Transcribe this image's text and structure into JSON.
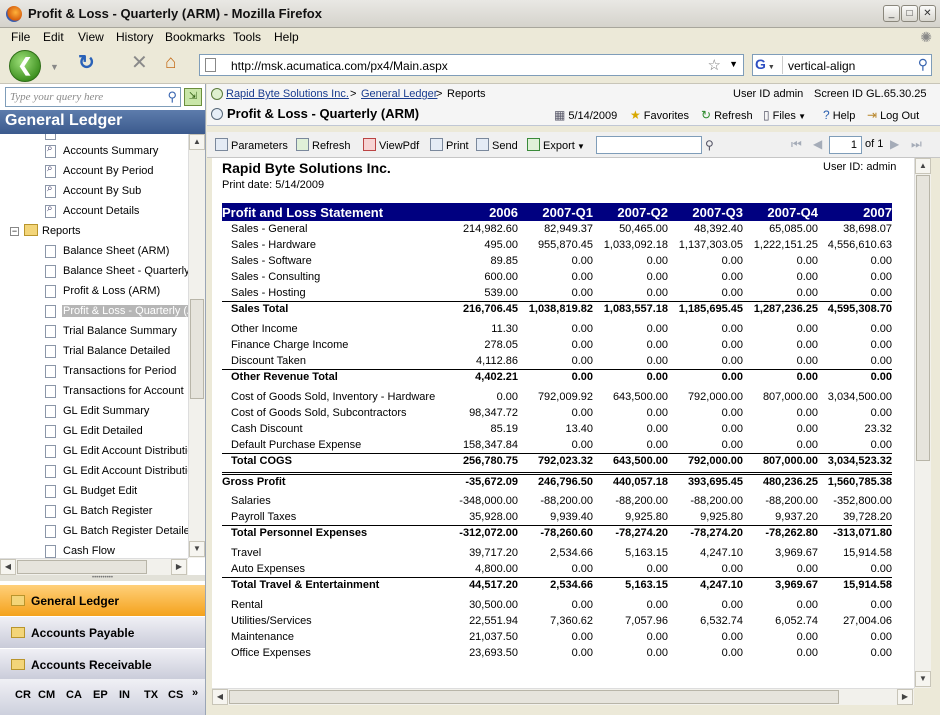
{
  "browser": {
    "title": "Profit & Loss - Quarterly (ARM) - Mozilla Firefox",
    "menu": [
      "File",
      "Edit",
      "View",
      "History",
      "Bookmarks",
      "Tools",
      "Help"
    ],
    "url": "http://msk.acumatica.com/px4/Main.aspx",
    "search_value": "vertical-align",
    "search_engine": "G"
  },
  "sidebar": {
    "query_placeholder": "Type your query here",
    "header": "General Ledger",
    "items": [
      {
        "label": "Accounts Summary",
        "icon": "search-report-icon"
      },
      {
        "label": "Account By Period",
        "icon": "search-report-icon"
      },
      {
        "label": "Account By Sub",
        "icon": "search-report-icon"
      },
      {
        "label": "Account Details",
        "icon": "search-report-icon"
      },
      {
        "label": "Reports",
        "icon": "folder-icon",
        "folder": true
      },
      {
        "label": "Balance Sheet (ARM)",
        "icon": "report-icon"
      },
      {
        "label": "Balance Sheet - Quarterly",
        "icon": "report-icon"
      },
      {
        "label": "Profit & Loss (ARM)",
        "icon": "report-icon"
      },
      {
        "label": "Profit & Loss - Quarterly (ARM)",
        "icon": "report-icon",
        "selected": true
      },
      {
        "label": "Trial Balance Summary",
        "icon": "report-icon"
      },
      {
        "label": "Trial Balance Detailed",
        "icon": "report-icon"
      },
      {
        "label": "Transactions for Period",
        "icon": "report-icon"
      },
      {
        "label": "Transactions for Account",
        "icon": "report-icon"
      },
      {
        "label": "GL Edit Summary",
        "icon": "report-icon"
      },
      {
        "label": "GL Edit Detailed",
        "icon": "report-icon"
      },
      {
        "label": "GL Edit Account Distribution",
        "icon": "report-icon"
      },
      {
        "label": "GL Edit Account Distribution",
        "icon": "report-icon"
      },
      {
        "label": "GL Budget Edit",
        "icon": "report-icon"
      },
      {
        "label": "GL Batch Register",
        "icon": "report-icon"
      },
      {
        "label": "GL Batch Register Detailed",
        "icon": "report-icon"
      },
      {
        "label": "Cash Flow",
        "icon": "report-icon"
      }
    ],
    "modules": [
      {
        "label": "General Ledger",
        "active": true
      },
      {
        "label": "Accounts Payable",
        "active": false
      },
      {
        "label": "Accounts Receivable",
        "active": false
      }
    ],
    "shortcuts": [
      "CR",
      "CM",
      "CA",
      "EP",
      "IN",
      "TX",
      "CS"
    ]
  },
  "header": {
    "breadcrumb_company": "Rapid Byte Solutions Inc.",
    "breadcrumb_module": "General Ledger",
    "breadcrumb_section": "Reports",
    "user_id": "User ID admin",
    "screen_id": "Screen ID GL.65.30.25",
    "screen_title": "Profit & Loss - Quarterly (ARM)",
    "date": "5/14/2009",
    "tools": [
      "Favorites",
      "Refresh",
      "Files",
      "Help",
      "Log Out"
    ]
  },
  "report_toolbar": {
    "buttons": [
      "Parameters",
      "Refresh",
      "ViewPdf",
      "Print",
      "Send",
      "Export"
    ],
    "page": "1",
    "page_of": "of 1"
  },
  "report": {
    "company": "Rapid Byte Solutions Inc.",
    "print_date": "Print date: 5/14/2009",
    "user": "User ID: admin",
    "heading": "Profit and Loss Statement",
    "columns": [
      "2006",
      "2007-Q1",
      "2007-Q2",
      "2007-Q3",
      "2007-Q4",
      "2007"
    ],
    "rows": [
      {
        "type": "line",
        "label": "Sales - General",
        "values": [
          "214,982.60",
          "82,949.37",
          "50,465.00",
          "48,392.40",
          "65,085.00",
          "38,698.07"
        ]
      },
      {
        "type": "line",
        "label": "Sales - Hardware",
        "values": [
          "495.00",
          "955,870.45",
          "1,033,092.18",
          "1,137,303.05",
          "1,222,151.25",
          "4,556,610.63"
        ]
      },
      {
        "type": "line",
        "label": "Sales - Software",
        "values": [
          "89.85",
          "0.00",
          "0.00",
          "0.00",
          "0.00",
          "0.00"
        ]
      },
      {
        "type": "line",
        "label": "Sales - Consulting",
        "values": [
          "600.00",
          "0.00",
          "0.00",
          "0.00",
          "0.00",
          "0.00"
        ]
      },
      {
        "type": "line",
        "label": "Sales - Hosting",
        "values": [
          "539.00",
          "0.00",
          "0.00",
          "0.00",
          "0.00",
          "0.00"
        ]
      },
      {
        "type": "total",
        "label": "Sales Total",
        "values": [
          "216,706.45",
          "1,038,819.82",
          "1,083,557.18",
          "1,185,695.45",
          "1,287,236.25",
          "4,595,308.70"
        ]
      },
      {
        "type": "line",
        "label": "Other Income",
        "values": [
          "11.30",
          "0.00",
          "0.00",
          "0.00",
          "0.00",
          "0.00"
        ]
      },
      {
        "type": "line",
        "label": "Finance Charge Income",
        "values": [
          "278.05",
          "0.00",
          "0.00",
          "0.00",
          "0.00",
          "0.00"
        ]
      },
      {
        "type": "line",
        "label": "Discount Taken",
        "values": [
          "4,112.86",
          "0.00",
          "0.00",
          "0.00",
          "0.00",
          "0.00"
        ]
      },
      {
        "type": "total",
        "label": "Other Revenue Total",
        "values": [
          "4,402.21",
          "0.00",
          "0.00",
          "0.00",
          "0.00",
          "0.00"
        ]
      },
      {
        "type": "line",
        "label": "Cost of Goods Sold, Inventory - Hardware",
        "values": [
          "0.00",
          "792,009.92",
          "643,500.00",
          "792,000.00",
          "807,000.00",
          "3,034,500.00"
        ]
      },
      {
        "type": "line",
        "label": "Cost of Goods Sold, Subcontractors",
        "values": [
          "98,347.72",
          "0.00",
          "0.00",
          "0.00",
          "0.00",
          "0.00"
        ]
      },
      {
        "type": "line",
        "label": "Cash Discount",
        "values": [
          "85.19",
          "13.40",
          "0.00",
          "0.00",
          "0.00",
          "23.32"
        ]
      },
      {
        "type": "line",
        "label": "Default Purchase Expense",
        "values": [
          "158,347.84",
          "0.00",
          "0.00",
          "0.00",
          "0.00",
          "0.00"
        ]
      },
      {
        "type": "total",
        "label": "Total COGS",
        "values": [
          "256,780.75",
          "792,023.32",
          "643,500.00",
          "792,000.00",
          "807,000.00",
          "3,034,523.32"
        ]
      },
      {
        "type": "gross",
        "label": "Gross Profit",
        "values": [
          "-35,672.09",
          "246,796.50",
          "440,057.18",
          "393,695.45",
          "480,236.25",
          "1,560,785.38"
        ]
      },
      {
        "type": "line",
        "label": "Salaries",
        "values": [
          "-348,000.00",
          "-88,200.00",
          "-88,200.00",
          "-88,200.00",
          "-88,200.00",
          "-352,800.00"
        ]
      },
      {
        "type": "line",
        "label": "Payroll Taxes",
        "values": [
          "35,928.00",
          "9,939.40",
          "9,925.80",
          "9,925.80",
          "9,937.20",
          "39,728.20"
        ]
      },
      {
        "type": "total",
        "label": "Total Personnel Expenses",
        "values": [
          "-312,072.00",
          "-78,260.60",
          "-78,274.20",
          "-78,274.20",
          "-78,262.80",
          "-313,071.80"
        ]
      },
      {
        "type": "line",
        "label": "Travel",
        "values": [
          "39,717.20",
          "2,534.66",
          "5,163.15",
          "4,247.10",
          "3,969.67",
          "15,914.58"
        ]
      },
      {
        "type": "line",
        "label": "Auto Expenses",
        "values": [
          "4,800.00",
          "0.00",
          "0.00",
          "0.00",
          "0.00",
          "0.00"
        ]
      },
      {
        "type": "total",
        "label": "Total Travel & Entertainment",
        "values": [
          "44,517.20",
          "2,534.66",
          "5,163.15",
          "4,247.10",
          "3,969.67",
          "15,914.58"
        ]
      },
      {
        "type": "line",
        "label": "Rental",
        "values": [
          "30,500.00",
          "0.00",
          "0.00",
          "0.00",
          "0.00",
          "0.00"
        ]
      },
      {
        "type": "line",
        "label": "Utilities/Services",
        "values": [
          "22,551.94",
          "7,360.62",
          "7,057.96",
          "6,532.74",
          "6,052.74",
          "27,004.06"
        ]
      },
      {
        "type": "line",
        "label": "Maintenance",
        "values": [
          "21,037.50",
          "0.00",
          "0.00",
          "0.00",
          "0.00",
          "0.00"
        ]
      },
      {
        "type": "line",
        "label": "Office Expenses",
        "values": [
          "23,693.50",
          "0.00",
          "0.00",
          "0.00",
          "0.00",
          "0.00"
        ]
      }
    ]
  }
}
